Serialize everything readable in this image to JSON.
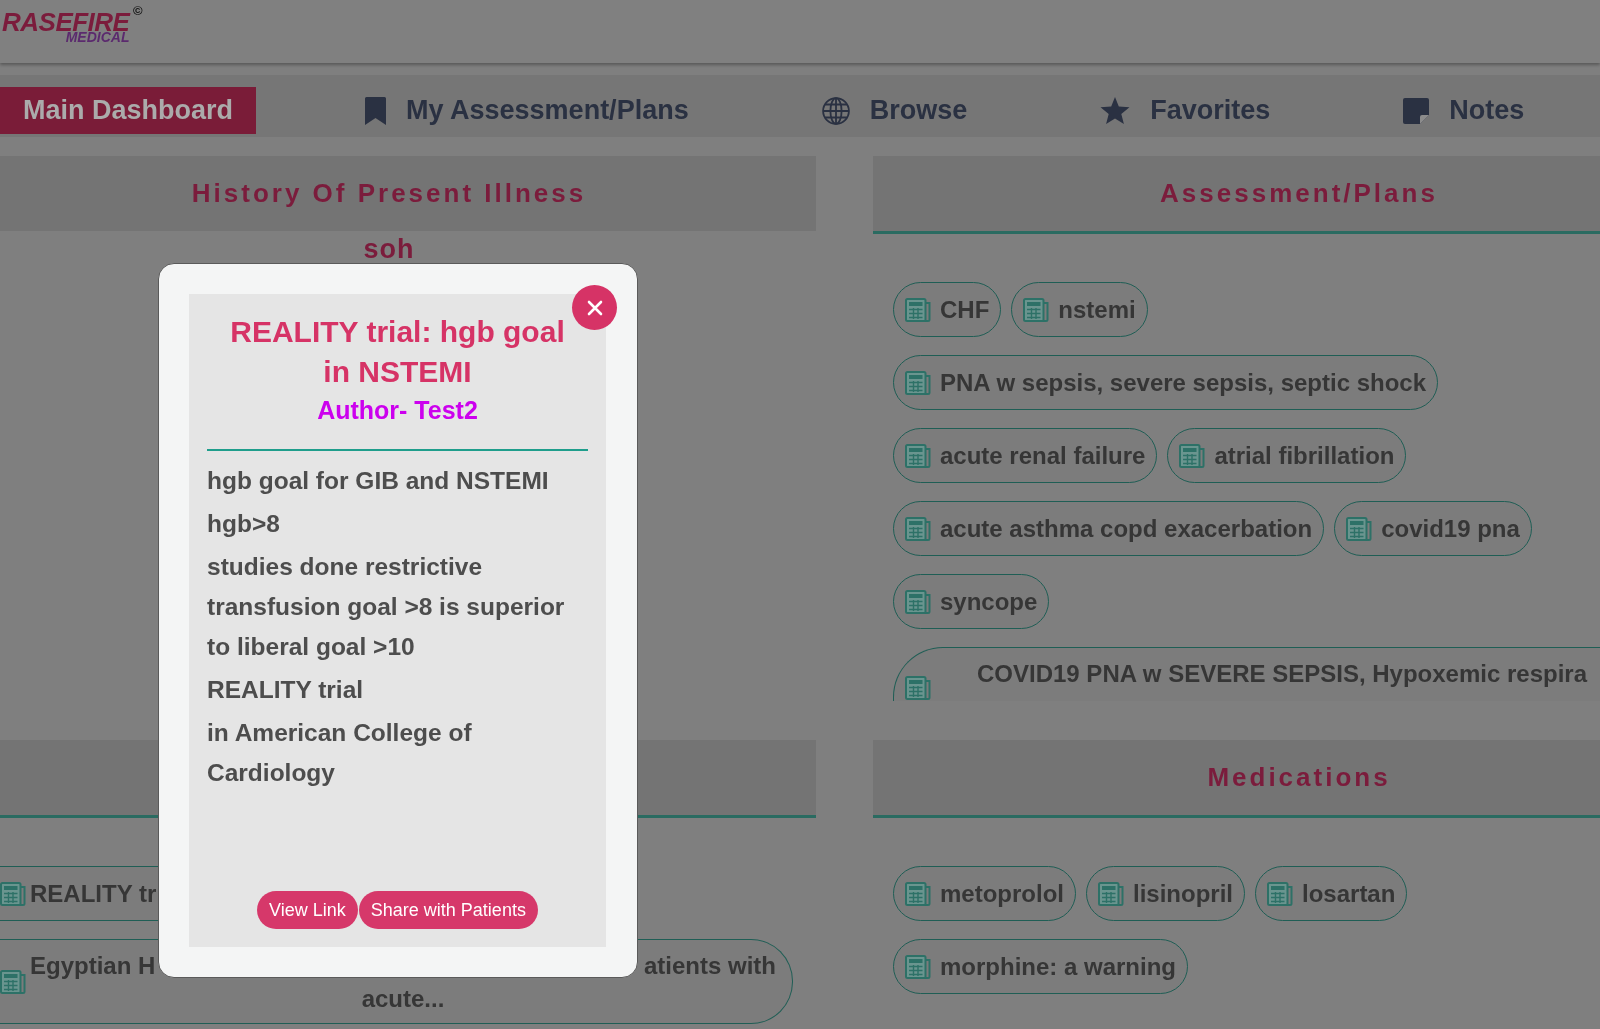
{
  "header": {
    "logo": {
      "wordmark": "RASEFIRE",
      "subtitle": "MEDICAL",
      "mark": "©"
    }
  },
  "nav": [
    {
      "label": "Main Dashboard",
      "selected": true
    },
    {
      "label": "My Assessment/Plans",
      "selected": false
    },
    {
      "label": "Browse",
      "selected": false
    },
    {
      "label": "Favorites",
      "selected": false
    },
    {
      "label": "Notes",
      "selected": false
    }
  ],
  "panels": [
    {
      "title": "History Of Present Illness",
      "underlined": false,
      "notes": [
        "soh"
      ]
    },
    {
      "title": "Assessment/Plans",
      "underlined": true,
      "chips": [
        {
          "kind": "pill",
          "text": "CHF"
        },
        {
          "kind": "pill",
          "text": "nstemi"
        },
        {
          "kind": "pill",
          "text": "PNA w sepsis, severe sepsis, septic shock"
        },
        {
          "kind": "pill",
          "text": "acute renal failure"
        },
        {
          "kind": "pill",
          "text": "atrial fibrillation"
        },
        {
          "kind": "pill",
          "text": "acute asthma copd exacerbation"
        },
        {
          "kind": "pill",
          "text": "covid19 pna"
        },
        {
          "kind": "pill",
          "text": "syncope"
        },
        {
          "kind": "tall",
          "text": "COVID19 PNA w SEVERE SEPSIS, Hypoxemic respira"
        }
      ]
    },
    {
      "underlined": true,
      "chips": [
        {
          "kind": "clipped",
          "text": "REALITY tr"
        },
        {
          "kind": "split",
          "parts": [
            "Egyptian H",
            "atients with",
            "acute..."
          ]
        }
      ]
    },
    {
      "title": "Medications",
      "underlined": true,
      "chips": [
        {
          "kind": "pill",
          "text": "metoprolol"
        },
        {
          "kind": "pill",
          "text": "lisinopril"
        },
        {
          "kind": "pill",
          "text": "losartan"
        },
        {
          "kind": "pill",
          "text": "morphine: a warning"
        }
      ]
    }
  ],
  "dialog": {
    "title": "REALITY trial: hgb goal in NSTEMI",
    "author": "Author- Test2",
    "paragraphs": [
      "hgb goal for GIB and NSTEMI",
      "hgb>8",
      "studies done restrictive transfusion goal >8 is superior to liberal goal >10",
      "REALITY trial",
      "in American College of Cardiology"
    ],
    "buttons": [
      "View Link",
      "Share with Patients"
    ]
  }
}
